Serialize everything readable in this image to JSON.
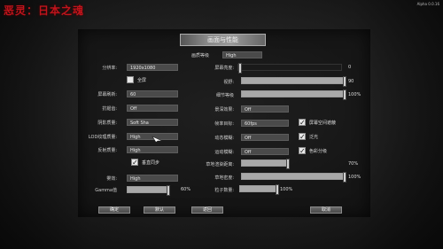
{
  "brand": "恶灵：日本之魂",
  "version": "Alpha 0.0.16",
  "title": "画面与性能",
  "quality": {
    "label": "画质等级",
    "value": "High"
  },
  "left": [
    {
      "key": "resolution",
      "label": "分辨率:",
      "value": "1920x1080"
    },
    {
      "key": "refresh",
      "label": "屏幕刷新:",
      "value": "60"
    },
    {
      "key": "aa",
      "label": "抗锯齿:",
      "value": "Off"
    },
    {
      "key": "shadow",
      "label": "阴影质量:",
      "value": "Soft Sha"
    },
    {
      "key": "texture",
      "label": "LOD纹理质量:",
      "value": "High"
    },
    {
      "key": "reflection",
      "label": "反射质量:",
      "value": "High"
    },
    {
      "key": "fog",
      "label": "雾效:",
      "value": "High"
    }
  ],
  "checks_left": [
    {
      "label": "全屏",
      "checked": false
    },
    {
      "label": "垂直同步",
      "checked": true
    }
  ],
  "gamma": {
    "label": "Gamma值",
    "value": "60%",
    "fraction": 0.6
  },
  "right_sliders": [
    {
      "label": "屏幕亮度:",
      "value": "0",
      "fraction": 0.0
    },
    {
      "label": "视野:",
      "value": "90",
      "fraction": 1.0
    },
    {
      "label": "细节等级",
      "value": "100%",
      "fraction": 1.0
    }
  ],
  "right_fields": [
    {
      "label": "景深效果:",
      "value": "Off"
    },
    {
      "label": "帧率目标:",
      "value": "60fps"
    },
    {
      "label": "动态模糊:",
      "value": "Off"
    },
    {
      "label": "运动模糊:",
      "value": "Off"
    }
  ],
  "checks_right": [
    {
      "label": "屏幕空间遮蔽",
      "checked": true
    },
    {
      "label": "泛光",
      "checked": true
    },
    {
      "label": "色彩分级",
      "checked": true
    }
  ],
  "bottom_sliders": [
    {
      "label": "草地渲染距离:",
      "value": "70%",
      "fraction": 0.7
    },
    {
      "label": "草地密度:",
      "value": "100%",
      "fraction": 1.0
    },
    {
      "label": "粒子数量:",
      "value": "100%",
      "fraction": 1.0
    }
  ],
  "buttons": {
    "apply": "确定",
    "default": "默认",
    "back": "返回",
    "cancel": "取消"
  },
  "colors": {
    "brand": "#c0141c",
    "panel": "#2a2a2a"
  }
}
